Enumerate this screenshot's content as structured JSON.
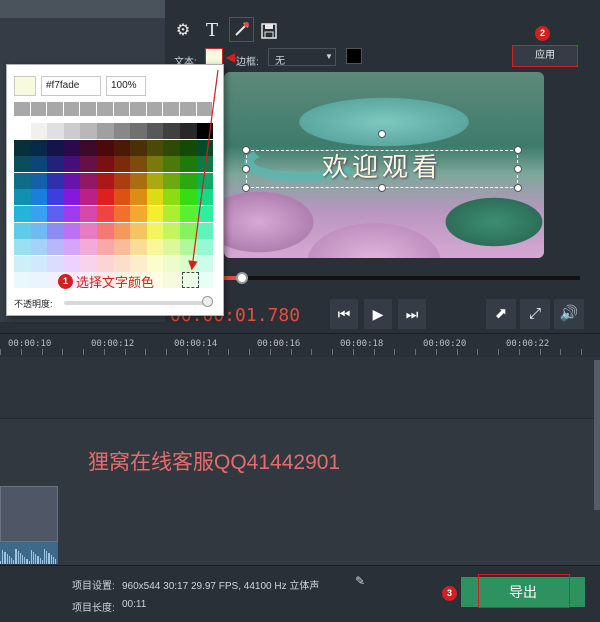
{
  "toolbar": {
    "text_tool_label": "T",
    "text_label": "文本:",
    "outline_label": "边框:",
    "outline_value": "无",
    "apply_label": "应用"
  },
  "video": {
    "overlay_text": "欢迎观看"
  },
  "player": {
    "time": "00:00:01.780",
    "progress_fraction": 0.05
  },
  "ruler": {
    "labels": [
      "00:00:10",
      "00:00:12",
      "00:00:14",
      "00:00:16",
      "00:00:18",
      "00:00:20",
      "00:00:22"
    ]
  },
  "watermark": {
    "text": "狸窝在线客服QQ41442901"
  },
  "project": {
    "settings_label": "项目设置:",
    "settings_value": "960x544 30:17 29.97 FPS, 44100 Hz 立体声",
    "length_label": "项目长度:",
    "length_value": "00:11"
  },
  "export": {
    "label": "导出"
  },
  "picker": {
    "hex_value": "#f7fade",
    "opacity_value": "100%",
    "opacity_label": "不透明度:",
    "selected_color": "#f7fade",
    "annotation": "选择文字颜色"
  },
  "badges": [
    "1",
    "2",
    "3"
  ],
  "colors": {
    "accent_red": "#d02020",
    "export_green": "#2e9160",
    "timecode_red": "#e74c3c"
  }
}
